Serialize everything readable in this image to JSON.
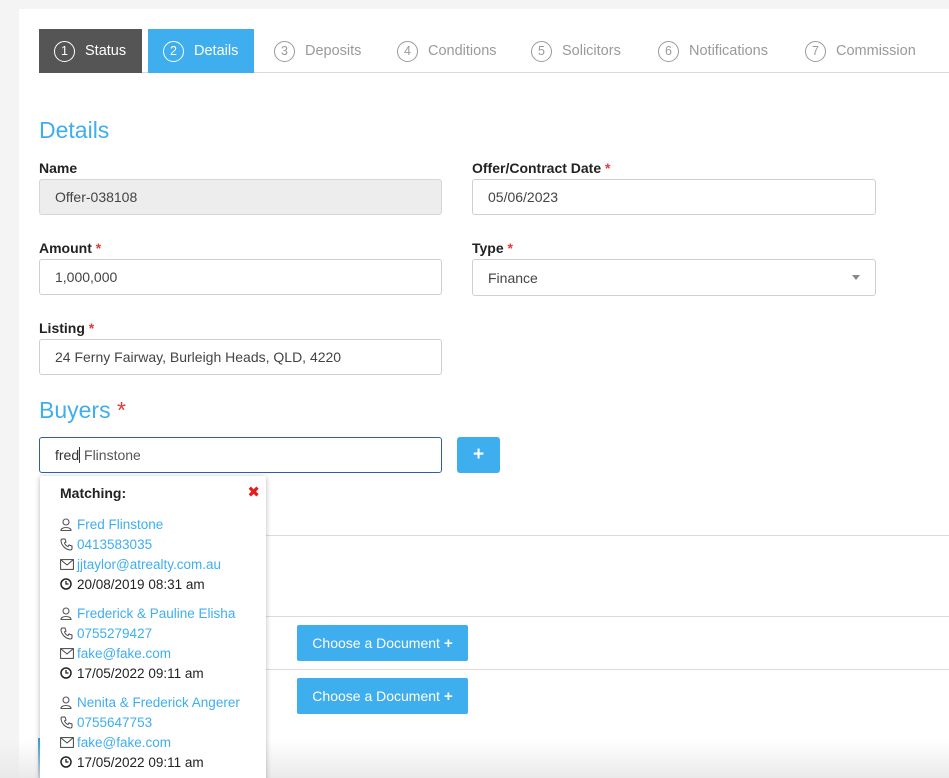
{
  "steps": [
    {
      "num": "1",
      "label": "Status"
    },
    {
      "num": "2",
      "label": "Details"
    },
    {
      "num": "3",
      "label": "Deposits"
    },
    {
      "num": "4",
      "label": "Conditions"
    },
    {
      "num": "5",
      "label": "Solicitors"
    },
    {
      "num": "6",
      "label": "Notifications"
    },
    {
      "num": "7",
      "label": "Commission"
    }
  ],
  "details": {
    "title": "Details",
    "name_label": "Name",
    "name_value": "Offer-038108",
    "date_label": "Offer/Contract Date",
    "date_value": "05/06/2023",
    "amount_label": "Amount",
    "amount_value": "1,000,000",
    "type_label": "Type",
    "type_value": "Finance",
    "listing_label": "Listing",
    "listing_value": "24 Ferny Fairway, Burleigh Heads, QLD, 4220",
    "required_mark": "*"
  },
  "buyers": {
    "title": "Buyers",
    "input_value_typed": "fred",
    "input_value_rest": " Flinstone",
    "add_button": "+"
  },
  "matching": {
    "heading": "Matching:",
    "close": "✖",
    "items": [
      {
        "name": "Fred Flinstone",
        "phone": "0413583035",
        "email": "jjtaylor@atrealty.com.au",
        "date": "20/08/2019 08:31 am"
      },
      {
        "name": "Frederick & Pauline Elisha",
        "phone": "0755279427",
        "email": "fake@fake.com",
        "date": "17/05/2022 09:11 am"
      },
      {
        "name": "Nenita & Frederick Angerer",
        "phone": "0755647753",
        "email": "fake@fake.com",
        "date": "17/05/2022 09:11 am"
      }
    ]
  },
  "documents": {
    "choose_label": "Choose a Document",
    "plus": "+"
  },
  "colors": {
    "accent": "#3eaeef",
    "done_step": "#555555",
    "required": "#e23a3a"
  }
}
